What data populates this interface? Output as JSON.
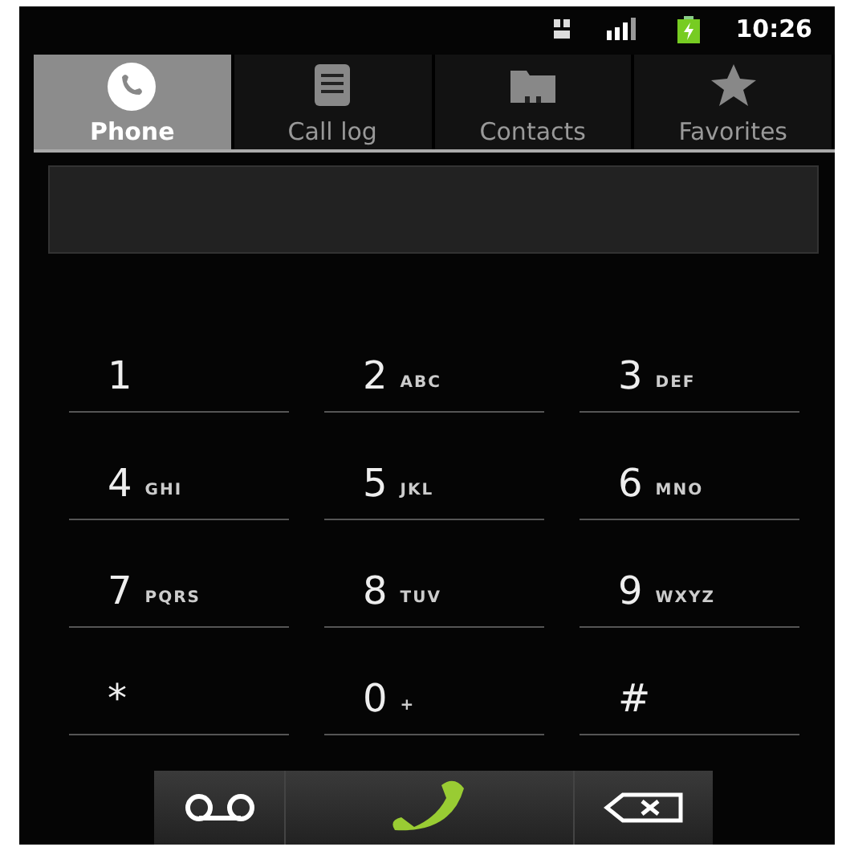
{
  "status_bar": {
    "time": "10:26"
  },
  "tabs": [
    {
      "label": "Phone",
      "kind": "phone",
      "selected": true
    },
    {
      "label": "Call log",
      "kind": "list",
      "selected": false
    },
    {
      "label": "Contacts",
      "kind": "folder",
      "selected": false
    },
    {
      "label": "Favorites",
      "kind": "star",
      "selected": false
    }
  ],
  "keypad": [
    {
      "digit": "1"
    },
    {
      "digit": "2",
      "letters": "ABC"
    },
    {
      "digit": "3",
      "letters": "DEF"
    },
    {
      "digit": "4",
      "letters": "GHI"
    },
    {
      "digit": "5",
      "letters": "JKL"
    },
    {
      "digit": "6",
      "letters": "MNO"
    },
    {
      "digit": "7",
      "letters": "PQRS"
    },
    {
      "digit": "8",
      "letters": "TUV"
    },
    {
      "digit": "9",
      "letters": "WXYZ"
    },
    {
      "digit": "*"
    },
    {
      "digit": "0",
      "letters": "+"
    },
    {
      "digit": "#"
    }
  ],
  "actions": [
    {
      "kind": "voicemail"
    },
    {
      "kind": "call"
    },
    {
      "kind": "delete"
    }
  ]
}
